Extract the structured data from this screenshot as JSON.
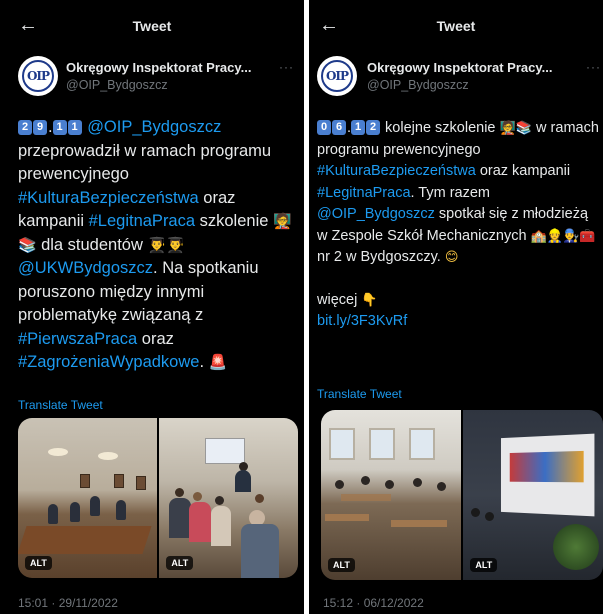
{
  "left": {
    "topbar": {
      "back_icon": "←",
      "title": "Tweet"
    },
    "author": {
      "name": "Okręgowy Inspektorat Pracy...",
      "handle": "@OIP_Bydgoszcz",
      "more": "···",
      "avatar_text": "OIP"
    },
    "text": {
      "date_keycaps": [
        "2",
        "9",
        "1",
        "1"
      ],
      "date_sep": ".",
      "mention": "@OIP_Bydgoszcz",
      "t1": " przeprowadził w ramach programu prewencyjnego ",
      "hashtag1": "#KulturaBezpieczeństwa",
      "t2": " oraz kampanii ",
      "hashtag2": "#LegitnaPraca",
      "t3": " szkolenie ",
      "emoji1": "🧑‍🏫📚",
      "t4": " dla studentów ",
      "emoji2": "👨‍🎓👨‍🎓",
      "mention2": "@UKWBydgoszcz",
      "t5": ". Na spotkaniu poruszono między innymi problematykę związaną z ",
      "hashtag3": "#PierwszaPraca",
      "t6": " oraz ",
      "hashtag4": "#ZagrożeniaWypadkowe",
      "t7": ". ",
      "emoji3": "🚨"
    },
    "translate": "Translate Tweet",
    "media": {
      "alt1": "ALT",
      "alt2": "ALT"
    },
    "timestamp": "15:01 · 29/11/2022"
  },
  "right": {
    "topbar": {
      "back_icon": "←",
      "title": "Tweet"
    },
    "author": {
      "name": "Okręgowy Inspektorat Pracy...",
      "handle": "@OIP_Bydgoszcz",
      "more": "···",
      "avatar_text": "OIP"
    },
    "text": {
      "date_keycaps": [
        "0",
        "6",
        "1",
        "2"
      ],
      "date_sep": ".",
      "t1": " kolejne szkolenie ",
      "emoji1": "🧑‍🏫📚",
      "t2": " w ramach programu prewencyjnego ",
      "hashtag1": "#KulturaBezpieczeństwa",
      "t3": " oraz kampanii ",
      "hashtag2": "#LegitnaPraca",
      "t4": ". Tym razem ",
      "mention": "@OIP_Bydgoszcz",
      "t5": " spotkał się z młodzieżą w Zespole Szkół Mechanicznych ",
      "emoji2": "🏫👷👨‍🔧🧰",
      "t6": " nr 2 w Bydgoszczy. ",
      "emoji3": "😊",
      "more_label": "więcej ",
      "emoji4": "👇",
      "link": "bit.ly/3F3KvRf"
    },
    "translate": "Translate Tweet",
    "media": {
      "alt1": "ALT",
      "alt2": "ALT"
    },
    "timestamp": "15:12 · 06/12/2022"
  }
}
